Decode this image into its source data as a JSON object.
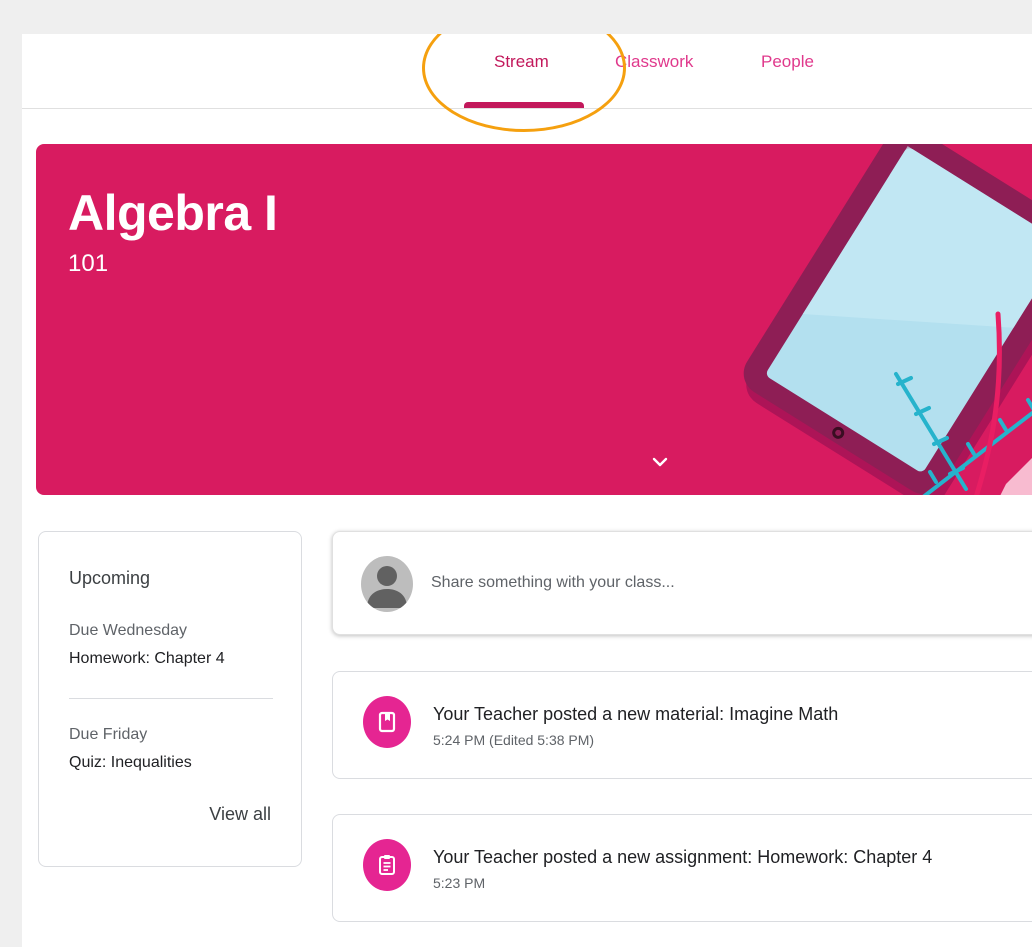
{
  "nav": {
    "tabs": [
      {
        "label": "Stream",
        "active": true
      },
      {
        "label": "Classwork",
        "active": false
      },
      {
        "label": "People",
        "active": false
      }
    ]
  },
  "banner": {
    "title": "Algebra I",
    "section": "101",
    "color": "#d81b60"
  },
  "upcoming": {
    "heading": "Upcoming",
    "items": [
      {
        "due": "Due Wednesday",
        "title": "Homework: Chapter 4"
      },
      {
        "due": "Due Friday",
        "title": "Quiz: Inequalities"
      }
    ],
    "view_all": "View all"
  },
  "share": {
    "placeholder": "Share something with your class..."
  },
  "posts": [
    {
      "icon": "book-icon",
      "title": "Your Teacher posted a new material: Imagine Math",
      "time": "5:24 PM (Edited 5:38 PM)"
    },
    {
      "icon": "assignment-icon",
      "title": "Your Teacher posted a new assignment: Homework: Chapter 4",
      "time": "5:23 PM"
    }
  ],
  "colors": {
    "accent": "#c2185b",
    "icon_bg": "#e52592",
    "annotation": "#f5a00f"
  }
}
